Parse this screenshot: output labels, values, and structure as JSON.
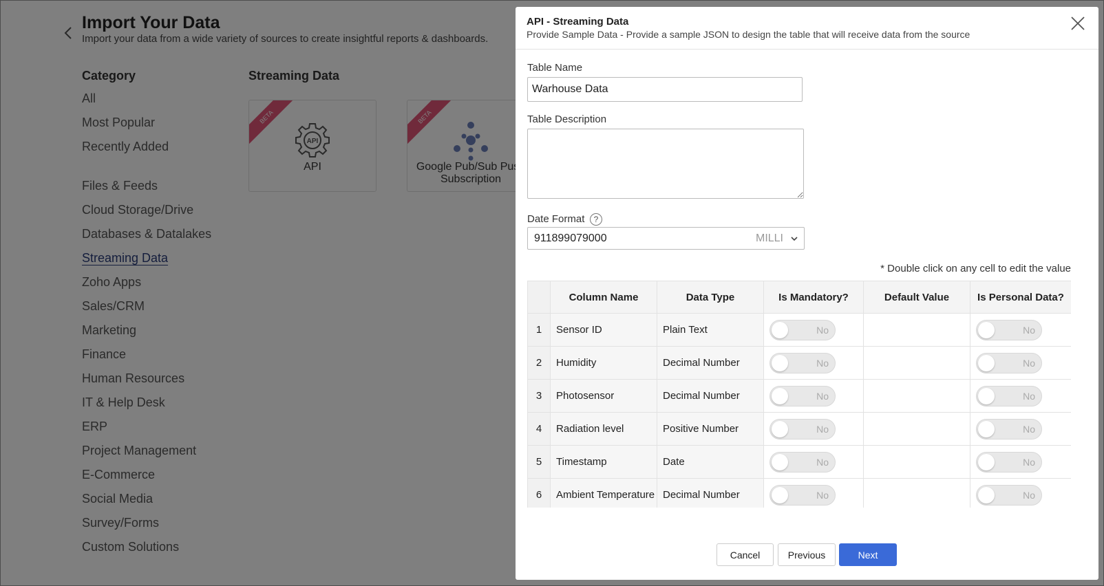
{
  "page": {
    "title": "Import Your Data",
    "subtitle": "Import your data from a wide variety of sources to create insightful reports & dashboards."
  },
  "sidebar": {
    "heading": "Category",
    "items": [
      {
        "label": "All"
      },
      {
        "label": "Most Popular"
      },
      {
        "label": "Recently Added"
      },
      {
        "label": "Files & Feeds"
      },
      {
        "label": "Cloud Storage/Drive"
      },
      {
        "label": "Databases & Datalakes"
      },
      {
        "label": "Streaming Data"
      },
      {
        "label": "Zoho Apps"
      },
      {
        "label": "Sales/CRM"
      },
      {
        "label": "Marketing"
      },
      {
        "label": "Finance"
      },
      {
        "label": "Human Resources"
      },
      {
        "label": "IT & Help Desk"
      },
      {
        "label": "ERP"
      },
      {
        "label": "Project Management"
      },
      {
        "label": "E-Commerce"
      },
      {
        "label": "Social Media"
      },
      {
        "label": "Survey/Forms"
      },
      {
        "label": "Custom Solutions"
      }
    ]
  },
  "streaming": {
    "heading": "Streaming Data",
    "tiles": [
      {
        "label": "API",
        "badge": "BETA",
        "icon": "api-gear-icon"
      },
      {
        "label": "Google Pub/Sub Push Subscription",
        "badge": "BETA",
        "icon": "pubsub-icon"
      }
    ]
  },
  "modal": {
    "title": "API - Streaming Data",
    "subtitle": "Provide Sample Data - Provide a sample JSON to design the table that will receive data from the source",
    "table_name_label": "Table Name",
    "table_name_value": "Warhouse Data",
    "table_desc_label": "Table Description",
    "table_desc_value": "",
    "date_format_label": "Date Format",
    "date_format_help": "?",
    "date_format_value": "911899079000",
    "date_format_unit": "MILLI",
    "edit_hint": "* Double click on any cell to edit the value",
    "columns": {
      "name": "Column Name",
      "type": "Data Type",
      "mandatory": "Is Mandatory?",
      "default": "Default Value",
      "personal": "Is Personal Data?"
    },
    "rows": [
      {
        "num": "1",
        "name": "Sensor ID",
        "type": "Plain Text",
        "mandatory": "No",
        "default": "",
        "personal": "No"
      },
      {
        "num": "2",
        "name": "Humidity",
        "type": "Decimal Number",
        "mandatory": "No",
        "default": "",
        "personal": "No"
      },
      {
        "num": "3",
        "name": "Photosensor",
        "type": "Decimal Number",
        "mandatory": "No",
        "default": "",
        "personal": "No"
      },
      {
        "num": "4",
        "name": "Radiation level",
        "type": "Positive Number",
        "mandatory": "No",
        "default": "",
        "personal": "No"
      },
      {
        "num": "5",
        "name": "Timestamp",
        "type": "Date",
        "mandatory": "No",
        "default": "",
        "personal": "No"
      },
      {
        "num": "6",
        "name": "Ambient Temperature",
        "type": "Decimal Number",
        "mandatory": "No",
        "default": "",
        "personal": "No"
      }
    ],
    "buttons": {
      "cancel": "Cancel",
      "previous": "Previous",
      "next": "Next"
    }
  },
  "colors": {
    "primary": "#3a6ad8",
    "badge": "#e05577",
    "active_category": "#2a3d7a"
  }
}
